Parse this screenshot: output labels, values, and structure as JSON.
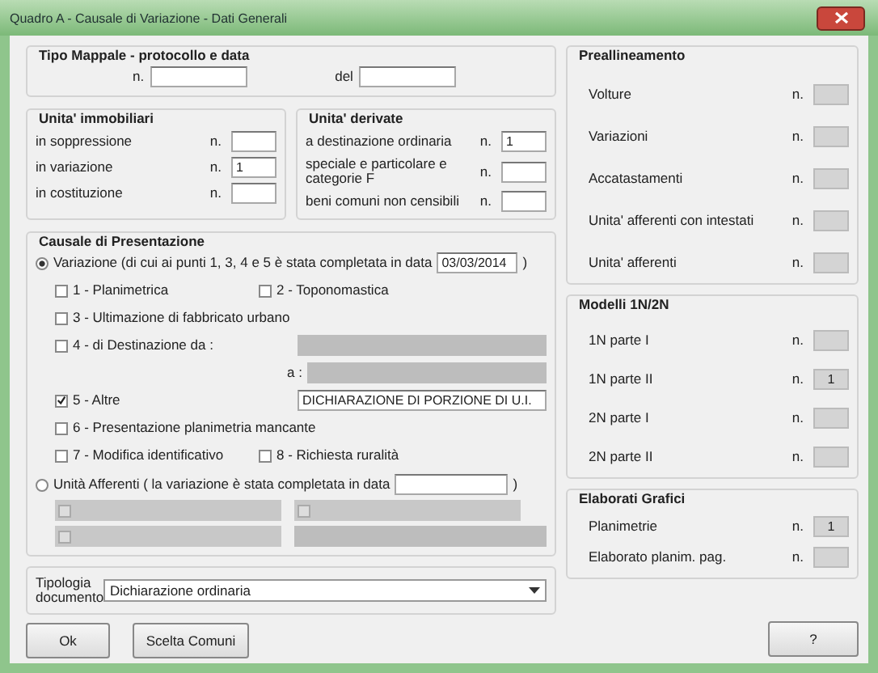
{
  "window": {
    "title": "Quadro A - Causale di Variazione - Dati Generali"
  },
  "tipo_mappale": {
    "title": "Tipo Mappale - protocollo e data",
    "n_label": "n.",
    "del_label": "del"
  },
  "unita_immobiliari": {
    "title": "Unita' immobiliari",
    "rows": [
      {
        "label": "in soppressione",
        "prefix": "n."
      },
      {
        "label": "in variazione",
        "prefix": "n.",
        "value": "1"
      },
      {
        "label": "in costituzione",
        "prefix": "n."
      }
    ]
  },
  "unita_derivate": {
    "title": "Unita' derivate",
    "rows": [
      {
        "label": "a destinazione ordinaria",
        "prefix": "n.",
        "value": "1"
      },
      {
        "label": "speciale e particolare e categorie F",
        "prefix": "n."
      },
      {
        "label": "beni comuni non censibili",
        "prefix": "n."
      }
    ]
  },
  "causale": {
    "title": "Causale di Presentazione",
    "variazione": {
      "label": "Variazione (di cui ai punti 1, 3, 4 e 5 è stata completata in data",
      "selected": true,
      "date": "03/03/2014",
      "close": ")"
    },
    "rows": [
      [
        {
          "kind": "checkbox",
          "label": "1 - Planimetrica",
          "checked": false
        },
        {
          "kind": "checkbox",
          "label": "2 - Toponomastica",
          "checked": false
        }
      ],
      [
        {
          "kind": "checkbox",
          "label": "3 - Ultimazione di fabbricato urbano",
          "checked": false
        }
      ],
      [
        {
          "kind": "checkbox",
          "label": "4 - di Destinazione da :",
          "checked": false,
          "field": {
            "disabled": true
          }
        }
      ],
      [
        {
          "kind": "label",
          "label": "a :",
          "field": {
            "disabled": true
          }
        }
      ],
      [
        {
          "kind": "checkbox",
          "label": "5 - Altre",
          "checked": true,
          "field": {
            "disabled": false,
            "value": "DICHIARAZIONE DI PORZIONE DI U.I."
          }
        }
      ],
      [
        {
          "kind": "checkbox",
          "label": "6 - Presentazione planimetria mancante",
          "checked": false
        }
      ],
      [
        {
          "kind": "checkbox",
          "label": "7 - Modifica identificativo",
          "checked": false
        },
        {
          "kind": "checkbox",
          "label": "8 - Richiesta ruralità",
          "checked": false
        }
      ]
    ],
    "afferenti": {
      "label": "Unità Afferenti ( la variazione è stata completata in data",
      "selected": false,
      "close": ")",
      "rows": [
        [
          {
            "kind": "checkbox",
            "checked": false
          },
          {
            "kind": "checkbox",
            "checked": false
          }
        ],
        [
          {
            "kind": "checkbox",
            "checked": false,
            "field": {
              "disabled": true
            }
          }
        ]
      ]
    }
  },
  "tipologia": {
    "label": "Tipologia documento",
    "value": "Dichiarazione ordinaria"
  },
  "buttons": [
    "Ok",
    "Scelta Comuni"
  ],
  "help_button": "?",
  "preallineamento": {
    "title": "Preallineamento",
    "rows": [
      {
        "label": "Volture",
        "prefix": "n."
      },
      {
        "label": "Variazioni",
        "prefix": "n."
      },
      {
        "label": "Accatastamenti",
        "prefix": "n."
      },
      {
        "label": "Unita' afferenti con intestati",
        "prefix": "n."
      },
      {
        "label": "Unita' afferenti",
        "prefix": "n."
      }
    ]
  },
  "modelli": {
    "title": "Modelli 1N/2N",
    "rows": [
      {
        "label": "1N parte I",
        "prefix": "n."
      },
      {
        "label": "1N parte II",
        "prefix": "n.",
        "value": "1"
      },
      {
        "label": "2N parte I",
        "prefix": "n."
      },
      {
        "label": "2N parte II",
        "prefix": "n."
      }
    ]
  },
  "elaborati": {
    "title": "Elaborati Grafici",
    "rows": [
      {
        "label": "Planimetrie",
        "prefix": "n.",
        "value": "1"
      },
      {
        "label": "Elaborato planim. pag.",
        "prefix": "n."
      }
    ]
  }
}
